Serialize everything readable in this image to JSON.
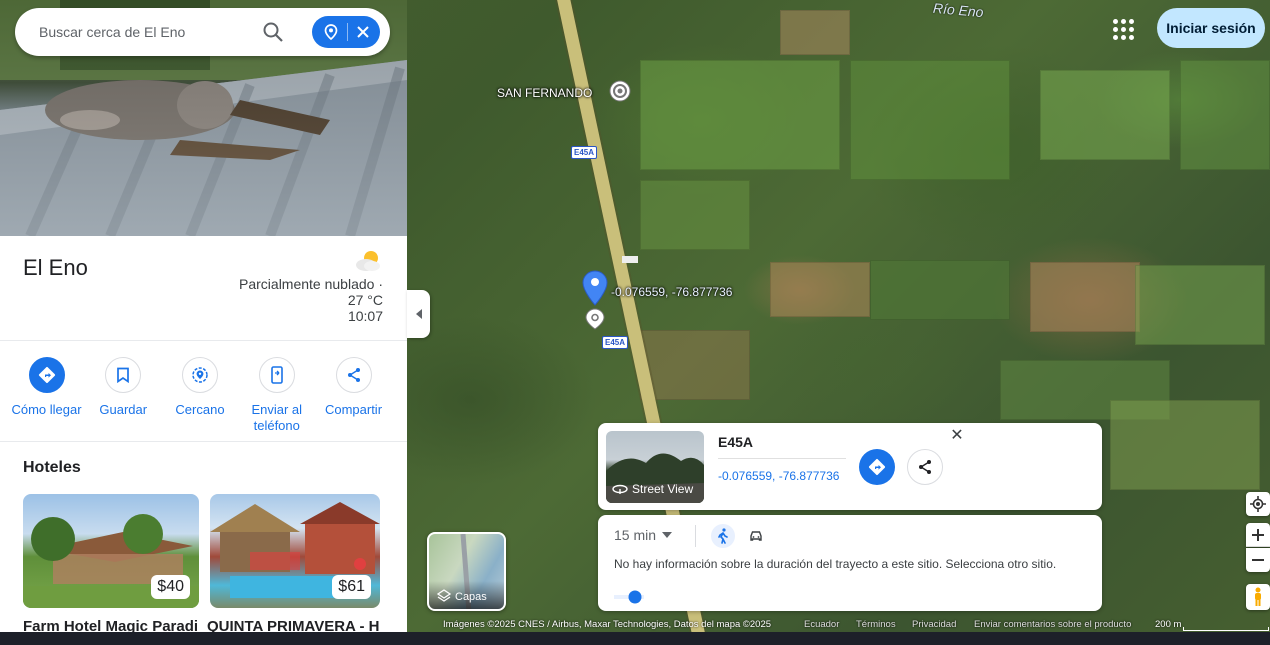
{
  "search": {
    "placeholder": "Buscar cerca de El Eno"
  },
  "place": {
    "name": "El Eno",
    "weather_line1": "Parcialmente nublado ·",
    "weather_line2": "27 °C",
    "weather_line3": "10:07"
  },
  "actions": [
    {
      "label": "Cómo llegar",
      "icon": "directions-icon"
    },
    {
      "label": "Guardar",
      "icon": "bookmark-icon"
    },
    {
      "label": "Cercano",
      "icon": "nearby-icon"
    },
    {
      "label": "Enviar al teléfono",
      "icon": "phone-icon"
    },
    {
      "label": "Compartir",
      "icon": "share-icon"
    }
  ],
  "hotels": {
    "title": "Hoteles",
    "items": [
      {
        "name": "Farm Hotel Magic Paradi…",
        "price": "$40"
      },
      {
        "name": "QUINTA PRIMAVERA - H…",
        "price": "$61"
      }
    ]
  },
  "map": {
    "river_label": "Río Eno",
    "town_label": "SAN FERNANDO",
    "highway_shield_1": "E45A",
    "highway_shield_2": "E45A",
    "pin_coords_label": "-0.076559, -76.877736"
  },
  "header": {
    "signin_label": "Iniciar sesión"
  },
  "pin_card": {
    "title": "E45A",
    "coords": "-0.076559, -76.877736",
    "street_view_label": "Street View"
  },
  "travel_card": {
    "time": "15 min",
    "message": "No hay información sobre la duración del trayecto a este sitio. Selecciona otro sitio."
  },
  "layers": {
    "label": "Capas"
  },
  "footer": {
    "attribution": "Imágenes ©2025 CNES / Airbus, Maxar Technologies, Datos del mapa ©2025",
    "country": "Ecuador",
    "terms": "Términos",
    "privacy": "Privacidad",
    "feedback": "Enviar comentarios sobre el producto",
    "scale": "200 m"
  },
  "colors": {
    "accent": "#1a73e8",
    "signin_bg": "#c2e7ff",
    "pin": "#4285f4"
  }
}
